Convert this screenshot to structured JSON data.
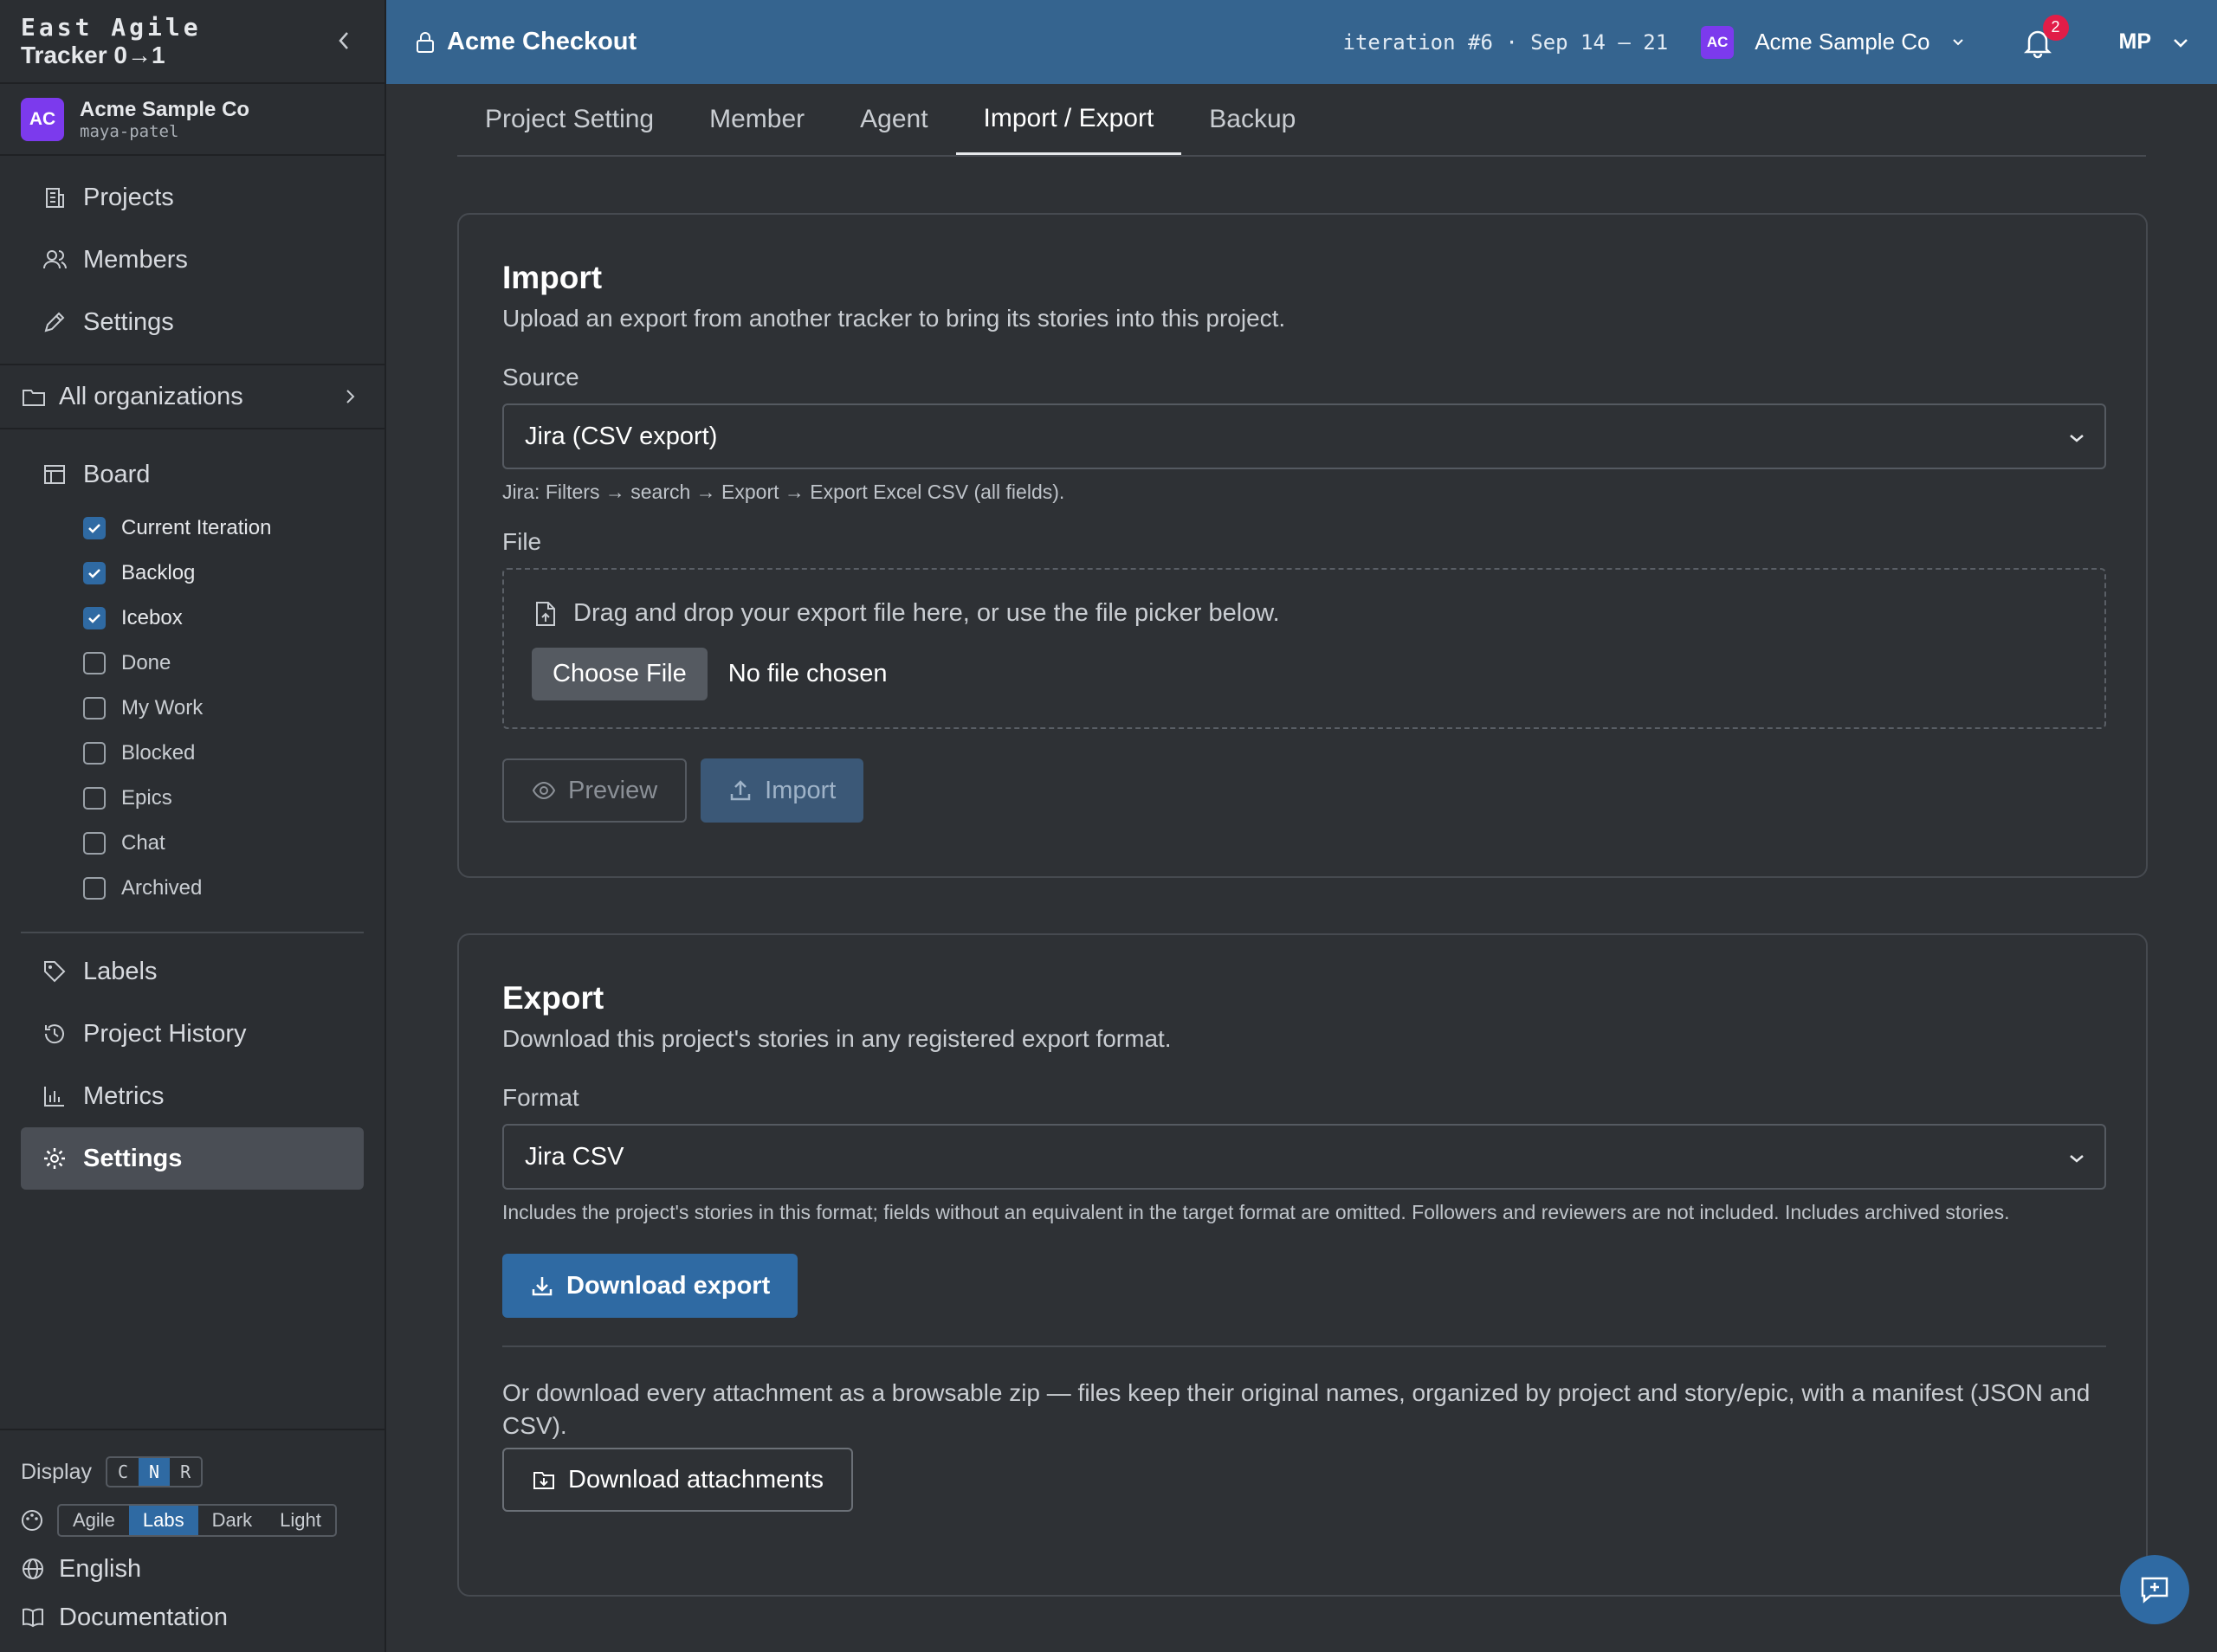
{
  "brand": {
    "line1": "East Agile",
    "line2": "Tracker 0→1"
  },
  "org": {
    "initials": "AC",
    "name": "Acme Sample Co",
    "user": "maya-patel"
  },
  "nav_top": [
    {
      "label": "Projects",
      "icon": "building-icon"
    },
    {
      "label": "Members",
      "icon": "users-icon"
    },
    {
      "label": "Settings",
      "icon": "pencil-icon"
    }
  ],
  "all_orgs": "All organizations",
  "board": {
    "label": "Board",
    "items": [
      {
        "label": "Current Iteration",
        "checked": true
      },
      {
        "label": "Backlog",
        "checked": true
      },
      {
        "label": "Icebox",
        "checked": true
      },
      {
        "label": "Done",
        "checked": false
      },
      {
        "label": "My Work",
        "checked": false
      },
      {
        "label": "Blocked",
        "checked": false
      },
      {
        "label": "Epics",
        "checked": false
      },
      {
        "label": "Chat",
        "checked": false
      },
      {
        "label": "Archived",
        "checked": false
      }
    ]
  },
  "nav_bottom": [
    {
      "label": "Labels",
      "icon": "tag-icon"
    },
    {
      "label": "Project History",
      "icon": "history-icon"
    },
    {
      "label": "Metrics",
      "icon": "bar-chart-icon"
    },
    {
      "label": "Settings",
      "icon": "gear-icon",
      "active": true
    }
  ],
  "footer": {
    "display_label": "Display",
    "display_options": [
      "C",
      "N",
      "R"
    ],
    "display_selected": "N",
    "theme_options": [
      "Agile",
      "Labs",
      "Dark",
      "Light"
    ],
    "theme_selected": "Labs",
    "language": "English",
    "docs": "Documentation"
  },
  "topbar": {
    "project": "Acme Checkout",
    "iteration": "iteration #6 · Sep 14 – 21",
    "org_initials": "AC",
    "org_name": "Acme Sample Co",
    "notifications": "2",
    "user_initials": "MP",
    "bg_color": "#35648f"
  },
  "tabs": [
    "Project Setting",
    "Member",
    "Agent",
    "Import / Export",
    "Backup"
  ],
  "active_tab": "Import / Export",
  "import": {
    "title": "Import",
    "desc": "Upload an export from another tracker to bring its stories into this project.",
    "source_label": "Source",
    "source_value": "Jira (CSV export)",
    "source_help": "Jira: Filters → search → Export → Export Excel CSV (all fields).",
    "file_label": "File",
    "dropzone_text": "Drag and drop your export file here, or use the file picker below.",
    "choose_file": "Choose File",
    "no_file": "No file chosen",
    "preview_btn": "Preview",
    "import_btn": "Import"
  },
  "export": {
    "title": "Export",
    "desc": "Download this project's stories in any registered export format.",
    "format_label": "Format",
    "format_value": "Jira CSV",
    "format_help": "Includes the project's stories in this format; fields without an equivalent in the target format are omitted. Followers and reviewers are not included. Includes archived stories.",
    "download_btn": "Download export",
    "attachments_text": "Or download every attachment as a browsable zip — files keep their original names, organized by project and story/epic, with a manifest (JSON and CSV).",
    "attachments_btn": "Download attachments"
  },
  "colors": {
    "accent": "#2f6aa3",
    "avatar": "#7c3aed",
    "badge": "#e11d48"
  }
}
